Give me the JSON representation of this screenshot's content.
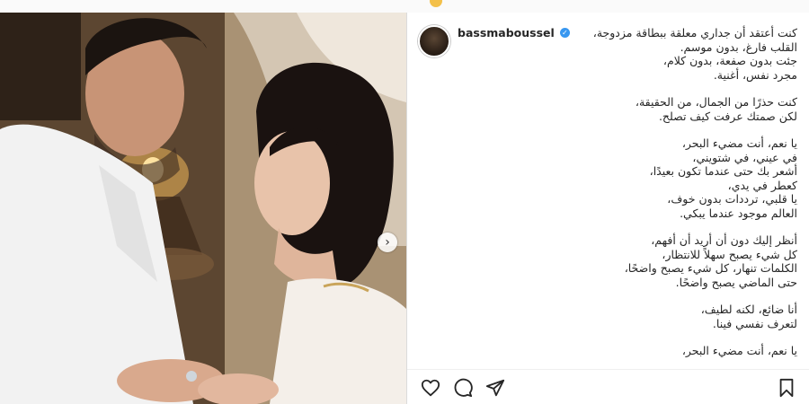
{
  "post": {
    "username": "bassmaboussel",
    "verified_icon": "verified-badge-icon",
    "first_line": "كنت أعتقد أن جداري معلقة ببطاقة مزدوجة،"
  },
  "caption": {
    "stanza1": [
      "القلب فارغ، بدون موسم.",
      "جئت بدون صفعة، بدون كلام،",
      "مجرد نفس، أغنية."
    ],
    "stanza2": [
      "كنت حذرًا من الجمال، من الحقيقة،",
      "لكن صمتك عرفت كيف تصلح."
    ],
    "stanza3": [
      "يا نعم، أنت مضيء البحر،",
      "في عيني، في شتويني،",
      "أشعر بك حتى عندما تكون بعيدًا،",
      "كعطر في يدي،",
      "يا قلبي، ترددات بدون خوف،",
      "العالم موجود عندما يبكي."
    ],
    "stanza4": [
      "أنظر إليك دون أن أريد أن أفهم،",
      "كل شيء يصبح سهلاً للانتظار،",
      "الكلمات تنهار، كل شيء يصبح واضحًا،",
      "حتى الماضي يصبح واضحًا."
    ],
    "stanza5": [
      "أنا ضائع، لكنه لطيف،",
      "لتعرف نفسي فينا."
    ],
    "stanza6": [
      "يا نعم، أنت مضيء البحر،"
    ]
  },
  "actions": {
    "like": "heart-icon",
    "comment": "comment-icon",
    "share": "share-icon",
    "save": "bookmark-icon"
  },
  "carousel": {
    "next": "chevron-right-icon"
  }
}
